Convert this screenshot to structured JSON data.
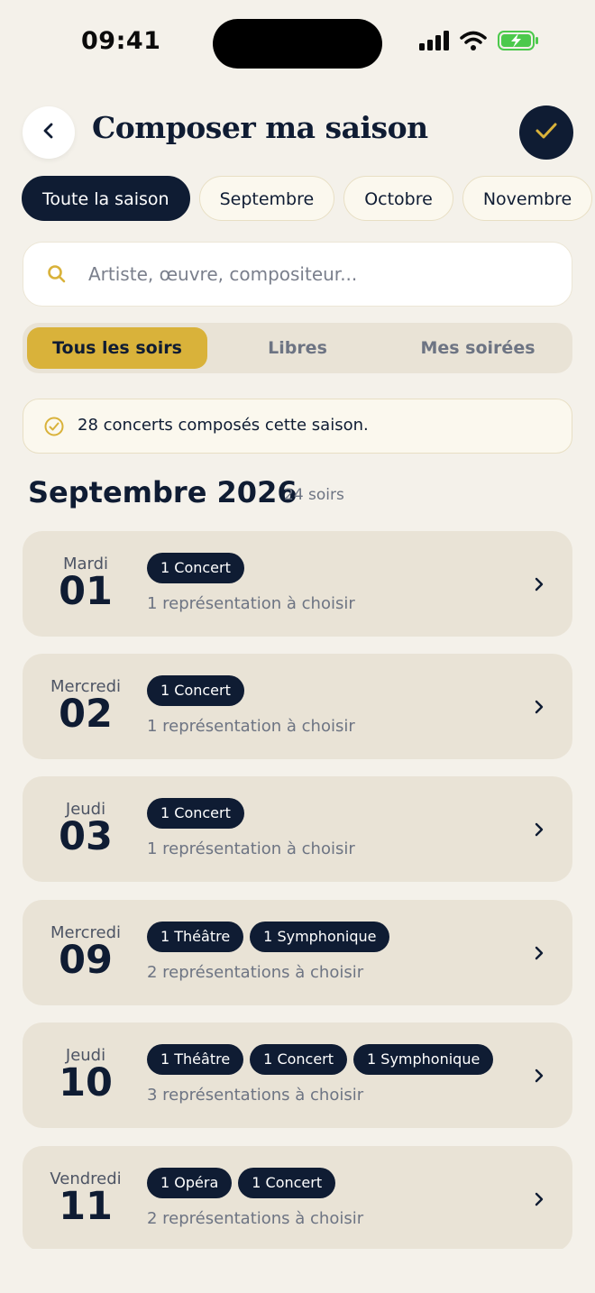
{
  "status_bar": {
    "time": "09:41"
  },
  "header": {
    "title": "Composer ma saison"
  },
  "months_filter": [
    "Toute la saison",
    "Septembre",
    "Octobre",
    "Novembre"
  ],
  "search": {
    "placeholder": "Artiste, œuvre, compositeur..."
  },
  "segments": [
    "Tous les soirs",
    "Libres",
    "Mes soirées"
  ],
  "notice": {
    "text": "28 concerts composés cette saison."
  },
  "month": {
    "title": "Septembre 2026",
    "count": "24 soirs"
  },
  "days": [
    {
      "weekday": "Mardi",
      "day": "01",
      "tags": [
        "1 Concert"
      ],
      "reps": "1 représentation à choisir"
    },
    {
      "weekday": "Mercredi",
      "day": "02",
      "tags": [
        "1 Concert"
      ],
      "reps": "1 représentation à choisir"
    },
    {
      "weekday": "Jeudi",
      "day": "03",
      "tags": [
        "1 Concert"
      ],
      "reps": "1 représentation à choisir"
    },
    {
      "weekday": "Mercredi",
      "day": "09",
      "tags": [
        "1 Théâtre",
        "1 Symphonique"
      ],
      "reps": "2 représentations à choisir"
    },
    {
      "weekday": "Jeudi",
      "day": "10",
      "tags": [
        "1 Théâtre",
        "1 Concert",
        "1 Symphonique"
      ],
      "reps": "3 représentations à choisir"
    },
    {
      "weekday": "Vendredi",
      "day": "11",
      "tags": [
        "1 Opéra",
        "1 Concert"
      ],
      "reps": "2 représentations à choisir"
    }
  ],
  "colors": {
    "navy": "#0f1c33",
    "gold": "#d9b23a",
    "background": "#f4f1ea",
    "card": "#e9e3d6"
  }
}
